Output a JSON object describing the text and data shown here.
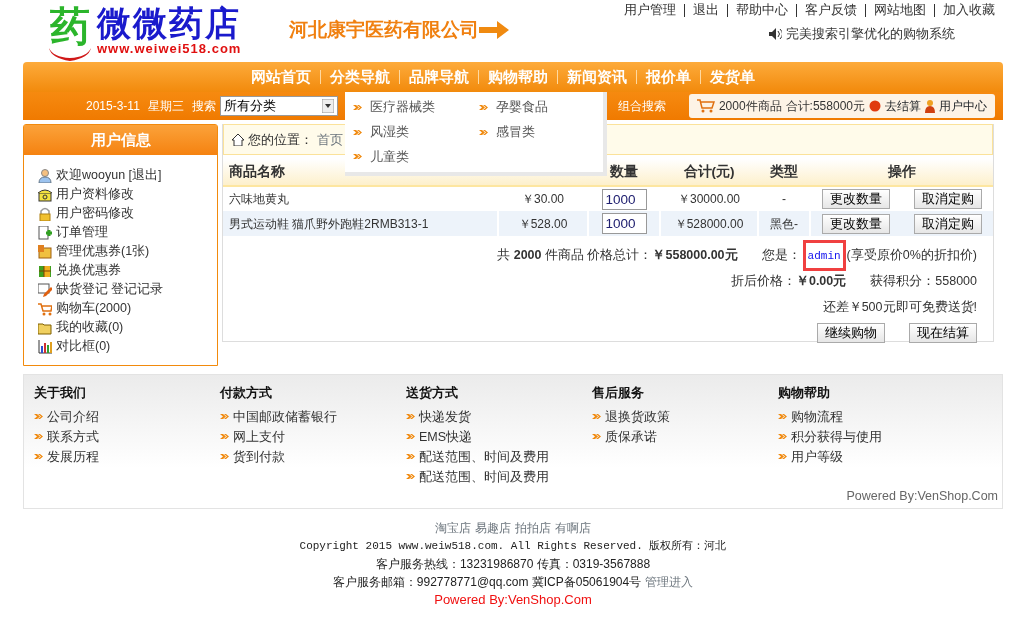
{
  "header": {
    "logo_mark": "药",
    "logo_text": "微微药店",
    "logo_url": "www.weiwei518.com",
    "company": "河北康宇医药有限公司",
    "top_links": [
      "用户管理",
      "退出",
      "帮助中心",
      "客户反馈",
      "网站地图",
      "加入收藏"
    ],
    "slogan": "完美搜索引擎优化的购物系统"
  },
  "nav": {
    "items": [
      "网站首页",
      "分类导航",
      "品牌导航",
      "购物帮助",
      "新闻资讯",
      "报价单",
      "发货单"
    ]
  },
  "search_bar": {
    "date": "2015-3-11",
    "weekday": "星期三",
    "label": "搜索",
    "category": "所有分类",
    "combo_search": "组合搜索",
    "cart_count": "2000件商品",
    "cart_total": "合计:558000元",
    "checkout": "去结算",
    "user_center": "用户中心"
  },
  "dropdown": {
    "items": [
      "医疗器械类",
      "孕婴食品",
      "风湿类",
      "感冒类",
      "儿童类"
    ]
  },
  "sidebar": {
    "title": "用户信息",
    "items": [
      "欢迎wooyun [退出]",
      "用户资料修改",
      "用户密码修改",
      "订单管理",
      "管理优惠券(1张)",
      "兑换优惠券",
      "缺货登记 登记记录",
      "购物车(2000)",
      "我的收藏(0)",
      "对比框(0)"
    ]
  },
  "breadcrumb": {
    "label": "您的位置：",
    "home": "首页"
  },
  "table": {
    "columns": [
      "商品名称",
      "数量",
      "合计(元)",
      "类型",
      "操作"
    ],
    "rows": [
      {
        "name": "六味地黄丸",
        "price": "￥30.00",
        "quantity": "1000",
        "total": "￥30000.00",
        "type": "-",
        "actions": [
          "更改数量",
          "取消定购"
        ]
      },
      {
        "name": "男式运动鞋 猫爪野外跑鞋2RMB313-1",
        "price": "￥528.00",
        "quantity": "1000",
        "total": "￥528000.00",
        "type": "黑色-",
        "actions": [
          "更改数量",
          "取消定购"
        ]
      }
    ]
  },
  "summary": {
    "totals": "共 **2000** 件商品 价格总计：**￥558000.00元**",
    "user_prefix": "您是：",
    "user": {
      "name": "admin",
      "highlighted": true
    },
    "user_suffix": "(享受原价0%的折扣价)",
    "discount": "折后价格：**￥0.00元**",
    "points": "获得积分：558000",
    "shipping_note": "还差￥500元即可免费送货!",
    "buttons": [
      "继续购物",
      "现在结算"
    ]
  },
  "footer_links": {
    "columns": [
      {
        "title": "关于我们",
        "links": [
          "公司介绍",
          "联系方式",
          "发展历程"
        ]
      },
      {
        "title": "付款方式",
        "links": [
          "中国邮政储蓄银行",
          "网上支付",
          "货到付款"
        ]
      },
      {
        "title": "送货方式",
        "links": [
          "快递发货",
          "EMS快递",
          "配送范围、时间及费用",
          "配送范围、时间及费用"
        ]
      },
      {
        "title": "售后服务",
        "links": [
          "退换货政策",
          "质保承诺"
        ]
      },
      {
        "title": "购物帮助",
        "links": [
          "购物流程",
          "积分获得与使用",
          "用户等级"
        ]
      }
    ],
    "powered": "Powered By:VenShop.Com"
  },
  "bottom": {
    "shops": [
      "淘宝店",
      "易趣店",
      "拍拍店",
      "有啊店"
    ],
    "copyright": "Copyright 2015 www.weiw518.com. All Rights Reserved. 版权所有：河北",
    "hotline": "客户服务热线：13231986870 传真：0319-3567888",
    "email_line": "客户服务邮箱：992778771@qq.com 冀ICP备05061904号",
    "admin_link": "管理进入",
    "powered": "Powered By:VenShop.Com"
  }
}
